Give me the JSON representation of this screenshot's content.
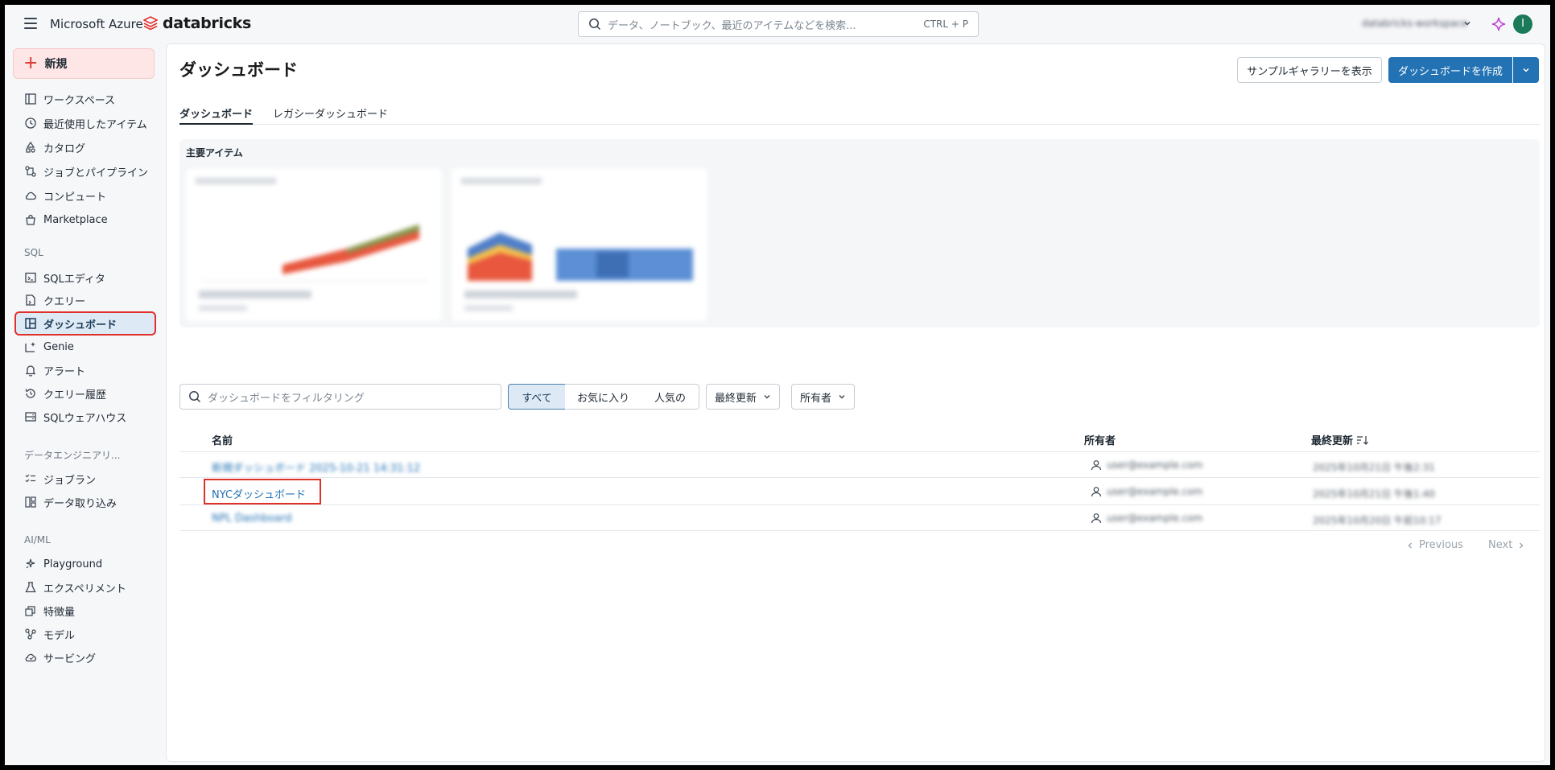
{
  "topbar": {
    "brand_microsoft": "Microsoft Azure",
    "brand_databricks": "databricks",
    "search_placeholder": "データ、ノートブック、最近のアイテムなどを検索...",
    "search_shortcut": "CTRL + P",
    "workspace_name": "databricks-workspace",
    "avatar_initial": "I"
  },
  "sidebar": {
    "new_label": "新規",
    "items_top": [
      {
        "label": "ワークスペース",
        "icon": "workspace-icon"
      },
      {
        "label": "最近使用したアイテム",
        "icon": "clock-icon"
      },
      {
        "label": "カタログ",
        "icon": "catalog-icon"
      },
      {
        "label": "ジョブとパイプライン",
        "icon": "jobs-icon"
      },
      {
        "label": "コンピュート",
        "icon": "cloud-icon"
      },
      {
        "label": "Marketplace",
        "icon": "marketplace-icon"
      }
    ],
    "section_sql": "SQL",
    "items_sql": [
      {
        "label": "SQLエディタ",
        "icon": "sql-editor-icon"
      },
      {
        "label": "クエリー",
        "icon": "query-icon"
      },
      {
        "label": "ダッシュボード",
        "icon": "dashboard-icon",
        "active": true
      },
      {
        "label": "Genie",
        "icon": "genie-icon"
      },
      {
        "label": "アラート",
        "icon": "bell-icon"
      },
      {
        "label": "クエリー履歴",
        "icon": "history-icon"
      },
      {
        "label": "SQLウェアハウス",
        "icon": "warehouse-icon"
      }
    ],
    "section_de": "データエンジニアリ...",
    "items_de": [
      {
        "label": "ジョブラン",
        "icon": "job-runs-icon"
      },
      {
        "label": "データ取り込み",
        "icon": "ingest-icon"
      }
    ],
    "section_ml": "AI/ML",
    "items_ml": [
      {
        "label": "Playground",
        "icon": "playground-icon"
      },
      {
        "label": "エクスペリメント",
        "icon": "flask-icon"
      },
      {
        "label": "特徴量",
        "icon": "features-icon"
      },
      {
        "label": "モデル",
        "icon": "models-icon"
      },
      {
        "label": "サービング",
        "icon": "serving-icon"
      }
    ]
  },
  "main": {
    "title": "ダッシュボード",
    "btn_sample_gallery": "サンプルギャラリーを表示",
    "btn_create": "ダッシュボードを作成",
    "tabs": [
      {
        "label": "ダッシュボード",
        "active": true
      },
      {
        "label": "レガシーダッシュボード",
        "active": false
      }
    ],
    "featured_title": "主要アイテム",
    "filter_placeholder": "ダッシュボードをフィルタリング",
    "segments": [
      "すべて",
      "お気に入り",
      "人気の"
    ],
    "dropdown_updated": "最終更新",
    "dropdown_owner": "所有者",
    "columns": {
      "name": "名前",
      "owner": "所有者",
      "updated": "最終更新"
    },
    "rows": [
      {
        "name": "新規ダッシュボード 2025-10-21 14:31:12",
        "owner": "user@example.com",
        "updated": "2025年10月21日 午後2:31"
      },
      {
        "name": "NYCダッシュボード",
        "owner": "user@example.com",
        "updated": "2025年10月21日 午後1:40"
      },
      {
        "name": "NPL Dashboard",
        "owner": "user@example.com",
        "updated": "2025年10月20日 午前10:17"
      }
    ],
    "pager_previous": "Previous",
    "pager_next": "Next"
  },
  "colors": {
    "accent": "#2272b4",
    "highlight": "#e0302a",
    "active_bg": "#dde9f5"
  }
}
